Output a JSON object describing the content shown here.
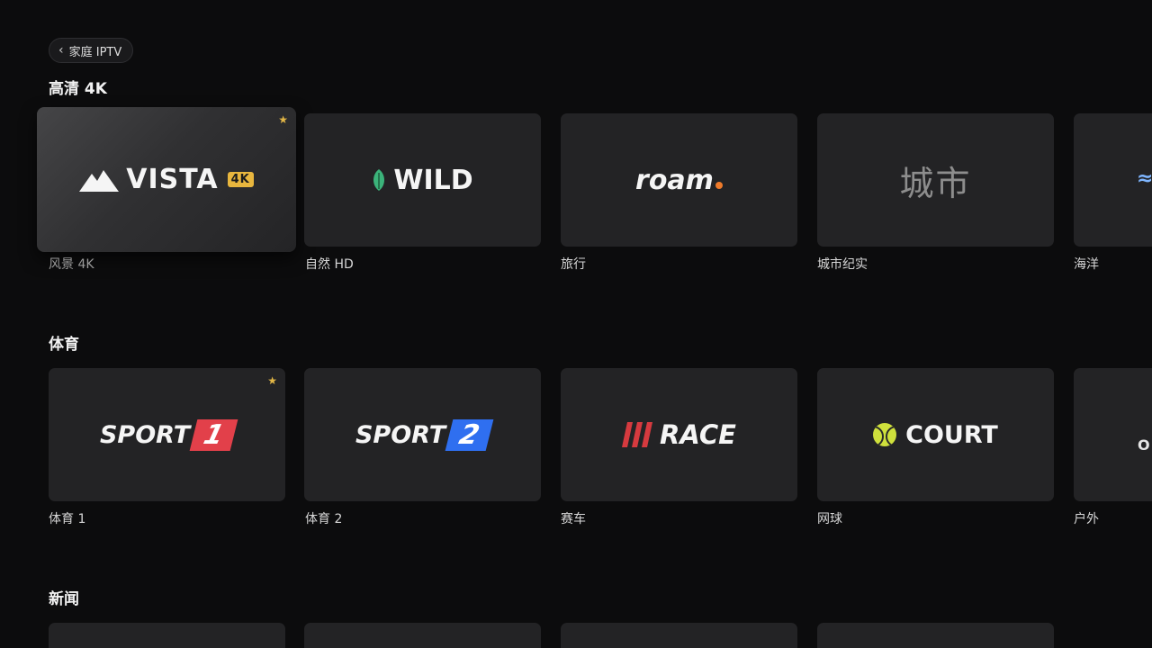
{
  "header": {
    "back_label": "家庭 IPTV"
  },
  "sections": [
    {
      "title": "高清 4K",
      "channels": [
        {
          "caption": "风景 4K",
          "logo_text": "VISTA",
          "badge": "4K",
          "favorite": true,
          "focused": true
        },
        {
          "caption": "自然 HD",
          "logo_text": "WILD",
          "favorite": false
        },
        {
          "caption": "旅行",
          "logo_text": "roam",
          "favorite": false
        },
        {
          "caption": "城市纪实",
          "logo_text": "城市",
          "favorite": false
        },
        {
          "caption": "海洋",
          "logo_text": "",
          "favorite": false
        }
      ]
    },
    {
      "title": "体育",
      "channels": [
        {
          "caption": "体育 1",
          "logo_text": "SPORT",
          "logo_number": "1",
          "favorite": true
        },
        {
          "caption": "体育 2",
          "logo_text": "SPORT",
          "logo_number": "2",
          "favorite": false
        },
        {
          "caption": "赛车",
          "logo_text": "RACE",
          "favorite": false
        },
        {
          "caption": "网球",
          "logo_text": "COURT",
          "favorite": false
        },
        {
          "caption": "户外",
          "logo_text": "O",
          "favorite": false
        }
      ]
    },
    {
      "title": "新闻",
      "channels": []
    }
  ],
  "colors": {
    "background": "#0c0c0d",
    "card": "#232325",
    "favorite_star": "#e2b646",
    "badge_4k": "#e8b63e",
    "wild_leaf": "#3bb37a",
    "roam_dot": "#ee7a2a",
    "sport1_accent": "#e2404a",
    "sport2_accent": "#2f6ff0",
    "race_accent": "#d63a3f",
    "court_ball": "#cfe03c"
  },
  "icons": {
    "back": "chevron-left-icon",
    "favorite": "star-icon",
    "vista": "mountain-icon",
    "wild": "leaf-icon",
    "court": "tennis-ball-icon"
  }
}
